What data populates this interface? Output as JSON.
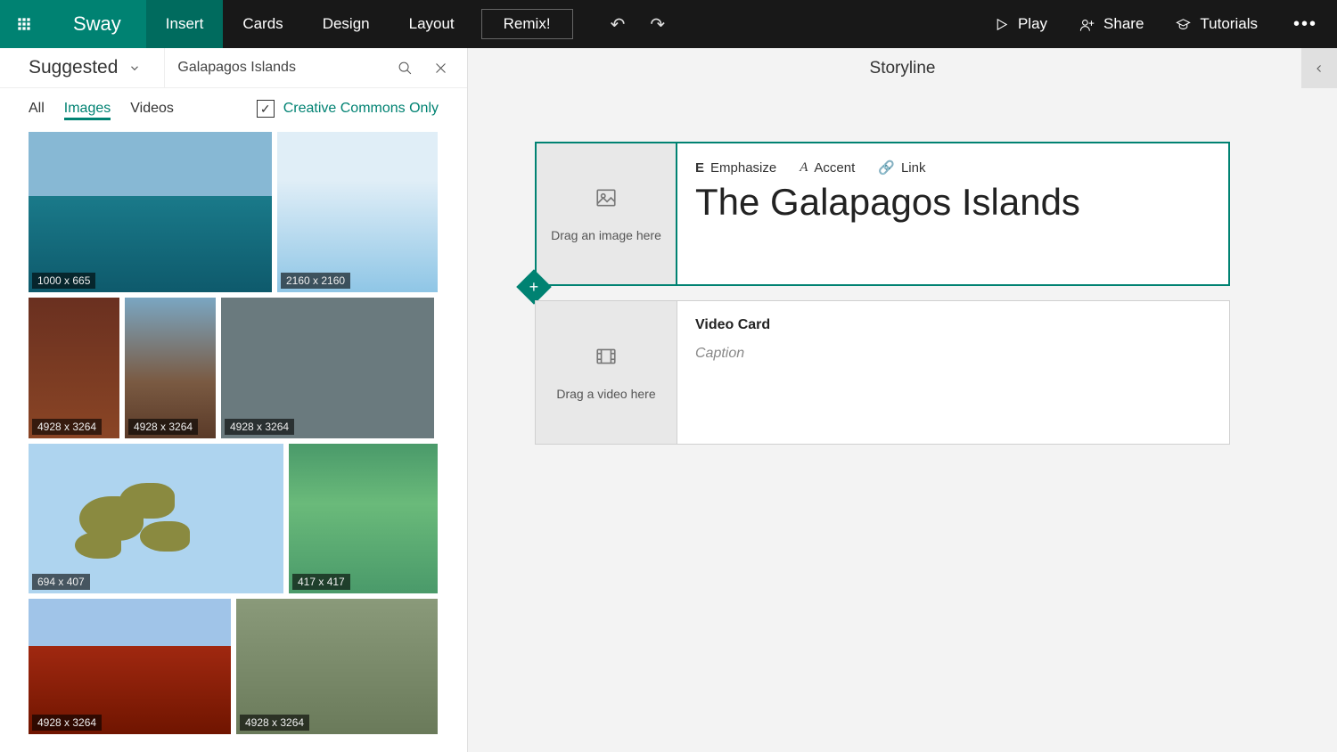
{
  "topbar": {
    "app": "Sway",
    "menu": [
      "Insert",
      "Cards",
      "Design",
      "Layout"
    ],
    "remix": "Remix!",
    "play": "Play",
    "share": "Share",
    "tutorials": "Tutorials"
  },
  "leftPanel": {
    "source": "Suggested",
    "search": {
      "value": "Galapagos Islands"
    },
    "tabs": [
      "All",
      "Images",
      "Videos"
    ],
    "activeTab": "Images",
    "ccOnly": "Creative Commons Only",
    "results": [
      {
        "dim": "1000 x 665"
      },
      {
        "dim": "2160 x 2160"
      },
      {
        "dim": "4928 x 3264"
      },
      {
        "dim": "4928 x 3264"
      },
      {
        "dim": "4928 x 3264"
      },
      {
        "dim": "694 x 407"
      },
      {
        "dim": "417 x 417"
      },
      {
        "dim": "4928 x 3264"
      },
      {
        "dim": "4928 x 3264"
      }
    ]
  },
  "storyline": {
    "header": "Storyline",
    "titleCard": {
      "dropText": "Drag an image here",
      "tools": {
        "emphasize": "Emphasize",
        "accent": "Accent",
        "link": "Link"
      },
      "title": "The Galapagos Islands"
    },
    "videoCard": {
      "dropText": "Drag a video here",
      "heading": "Video Card",
      "caption": "Caption"
    }
  }
}
